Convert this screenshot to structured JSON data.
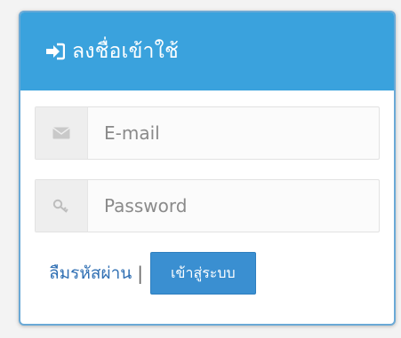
{
  "header": {
    "title": "ลงชื่อเข้าใช้",
    "icon": "sign-in-icon",
    "background": "#3aa2dd"
  },
  "email": {
    "icon": "envelope-icon",
    "placeholder": "E-mail",
    "value": ""
  },
  "password": {
    "icon": "key-icon",
    "placeholder": "Password",
    "value": ""
  },
  "actions": {
    "forgot_label": "ลืมรหัสผ่าน",
    "separator": "|",
    "login_label": "เข้าสู่ระบบ",
    "login_color": "#3a8fd1"
  }
}
